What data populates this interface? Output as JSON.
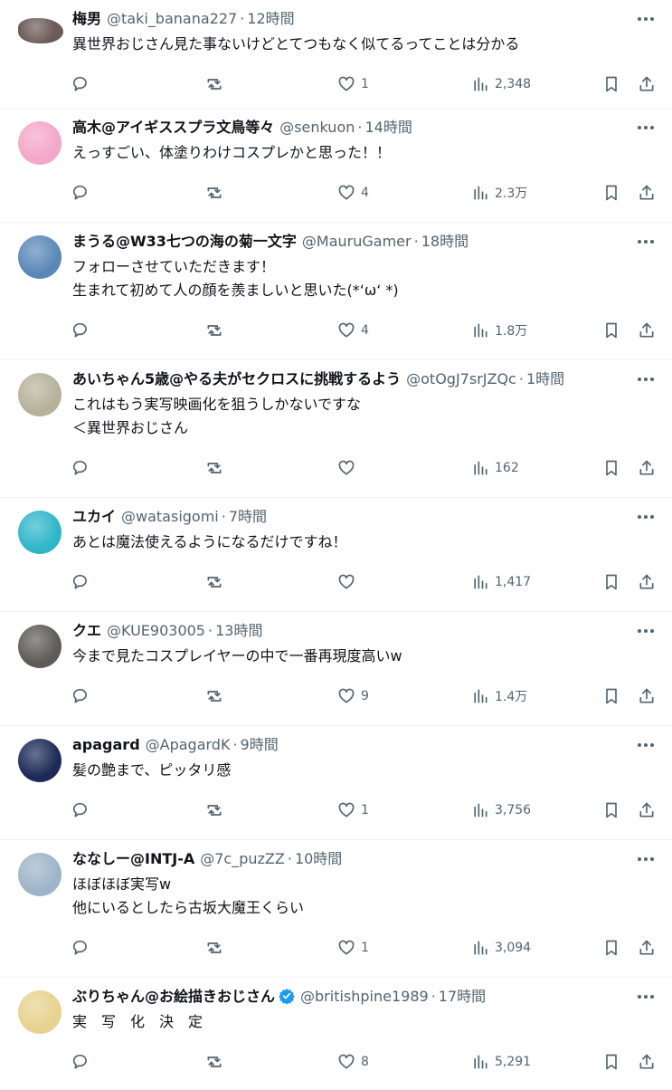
{
  "tweets": [
    {
      "name": "梅男",
      "handle": "@taki_banana227",
      "time": "12時間",
      "text": "異世界おじさん見た事ないけどとてつもなく似てるってことは分かる",
      "likes": "1",
      "views": "2,348",
      "avatar_color": "#6b5a57",
      "avatar_style": "blob",
      "verified": false
    },
    {
      "name": "高木@アイギススプラ文鳥等々",
      "handle": "@senkuon",
      "time": "14時間",
      "text": "えっすごい、体塗りわけコスプレかと思った！！",
      "likes": "4",
      "views": "2.3万",
      "avatar_color": "#f4a7c8",
      "avatar_style": "circle",
      "verified": false
    },
    {
      "name": "まうる@W33七つの海の菊一文字",
      "handle": "@MauruGamer",
      "time": "18時間",
      "text": "フォローさせていただきます！\n生まれて初めて人の顔を羨ましいと思いた(*‘ω‘ *)",
      "likes": "4",
      "views": "1.8万",
      "avatar_color": "#5b87b8",
      "avatar_style": "circle",
      "verified": false
    },
    {
      "name": "あいちゃん5歳@やる夫がセクロスに挑戦するよう",
      "handle": "@otOgJ7srJZQc",
      "time": "1時間",
      "text": "これはもう実写映画化を狙うしかないですな\n＜異世界おじさん",
      "likes": "",
      "views": "162",
      "avatar_color": "#b6b29a",
      "avatar_style": "circle",
      "verified": false
    },
    {
      "name": "ユカイ",
      "handle": "@watasigomi",
      "time": "7時間",
      "text": "あとは魔法使えるようになるだけですね！",
      "likes": "",
      "views": "1,417",
      "avatar_color": "#2fb6c9",
      "avatar_style": "circle",
      "verified": false
    },
    {
      "name": "クエ",
      "handle": "@KUE903005",
      "time": "13時間",
      "text": "今まで見たコスプレイヤーの中で一番再現度高いw",
      "likes": "9",
      "views": "1.4万",
      "avatar_color": "#5d5c57",
      "avatar_style": "circle",
      "verified": false
    },
    {
      "name": "apagard",
      "handle": "@ApagardK",
      "time": "9時間",
      "text": "髪の艶まで、ピッタリ感",
      "likes": "1",
      "views": "3,756",
      "avatar_color": "#1d2a57",
      "avatar_style": "circle",
      "verified": false
    },
    {
      "name": "ななしー@INTJ-A",
      "handle": "@7c_puzZZ",
      "time": "10時間",
      "text": "ほぼほぼ実写w\n他にいるとしたら古坂大魔王くらい",
      "likes": "1",
      "views": "3,094",
      "avatar_color": "#9db4c9",
      "avatar_style": "circle",
      "verified": false
    },
    {
      "name": "ぶりちゃん@お絵描きおじさん",
      "handle": "@britishpine1989",
      "time": "17時間",
      "text": "実　写　化　決　定",
      "likes": "8",
      "views": "5,291",
      "avatar_color": "#e7d28f",
      "avatar_style": "circle",
      "verified": true
    }
  ],
  "colors": {
    "text": "#0f1419",
    "muted": "#536471",
    "divider": "#eff3f4",
    "verified": "#1d9bf0"
  },
  "icons": [
    "reply-icon",
    "retweet-icon",
    "like-icon",
    "views-icon",
    "bookmark-icon",
    "share-icon",
    "more-icon",
    "verified-icon"
  ]
}
